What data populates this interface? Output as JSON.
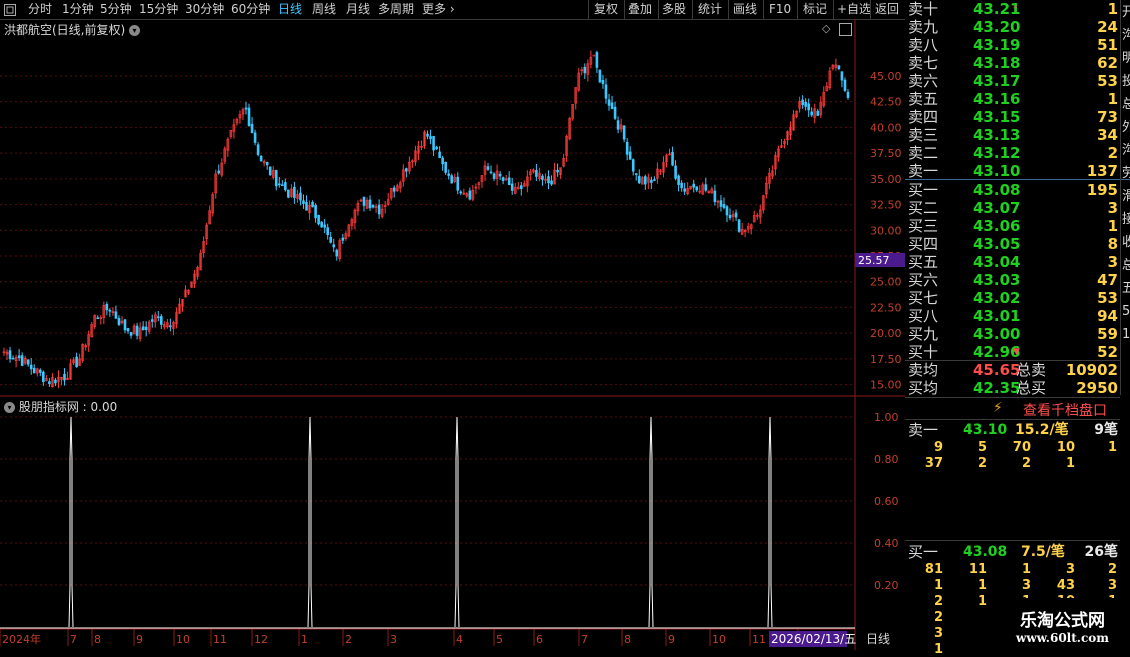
{
  "toolbar": {
    "periods": [
      "分时",
      "1分钟",
      "5分钟",
      "15分钟",
      "30分钟",
      "60分钟",
      "日线",
      "周线",
      "月线",
      "多周期",
      "更多"
    ],
    "active": "日线",
    "actions": [
      "复权",
      "叠加",
      "多股",
      "统计",
      "画线",
      "F10",
      "标记",
      "+自选",
      "返回"
    ]
  },
  "chart": {
    "title": "洪都航空(日线,前复权)",
    "price_ticks": [
      "45.00",
      "42.50",
      "40.00",
      "37.50",
      "35.00",
      "32.50",
      "30.00",
      "27.50",
      "25.00",
      "22.50",
      "20.00",
      "17.50",
      "15.00"
    ],
    "crosshair_price": "25.57",
    "indicator_title": "股朋指标网 : 0.00",
    "indicator_ticks": [
      "1.00",
      "0.80",
      "0.60",
      "0.40",
      "0.20"
    ],
    "x_labels": [
      "2024年",
      "7",
      "8",
      "9",
      "10",
      "11",
      "12",
      "1",
      "2",
      "3",
      "4",
      "5",
      "6",
      "7",
      "8",
      "9",
      "10",
      "11",
      "12"
    ],
    "date_badge": "2026/02/13/五",
    "period_label": "日线"
  },
  "chart_data": {
    "type": "line",
    "title": "洪都航空(日线,前复权)",
    "ylim": [
      13.5,
      48.5
    ],
    "x_categories": [
      "2024年",
      "7",
      "8",
      "9",
      "10",
      "11",
      "12",
      "1",
      "2",
      "3",
      "4",
      "5",
      "6",
      "7",
      "8",
      "9",
      "10",
      "11",
      "12"
    ],
    "series": [
      {
        "values": [
          18.2,
          17.6,
          16.4,
          15.4,
          15.8,
          17.5,
          21.5,
          22.5,
          20.5,
          20.0,
          21.5,
          21.0,
          23.5,
          27.0,
          35.0,
          39.0,
          42.0,
          37.0,
          35.0,
          33.5,
          32.5,
          31.0,
          27.5,
          31.5,
          33.0,
          32.0,
          34.5,
          37.0,
          39.5,
          36.5,
          34.5,
          33.5,
          36.0,
          35.0,
          33.5,
          35.5,
          34.5,
          36.0,
          44.5,
          47.0,
          43.0,
          39.5,
          35.0,
          34.5,
          37.5,
          34.0,
          34.5,
          33.5,
          32.0,
          30.0,
          31.5,
          36.0,
          40.0,
          42.5,
          41.0,
          46.5,
          43.1
        ]
      },
      {
        "name": "股朋指标网",
        "values": [
          0,
          1,
          0,
          0,
          1,
          0,
          1,
          0,
          1,
          0,
          1,
          0
        ],
        "ylim": [
          0,
          1
        ]
      }
    ]
  },
  "orderbook": {
    "asks": [
      {
        "label": "卖十",
        "price": "43.21",
        "vol": "1",
        "mark": "*"
      },
      {
        "label": "卖九",
        "price": "43.20",
        "vol": "24"
      },
      {
        "label": "卖八",
        "price": "43.19",
        "vol": "51"
      },
      {
        "label": "卖七",
        "price": "43.18",
        "vol": "62"
      },
      {
        "label": "卖六",
        "price": "43.17",
        "vol": "53"
      },
      {
        "label": "卖五",
        "price": "43.16",
        "vol": "1"
      },
      {
        "label": "卖四",
        "price": "43.15",
        "vol": "73"
      },
      {
        "label": "卖三",
        "price": "43.13",
        "vol": "34"
      },
      {
        "label": "卖二",
        "price": "43.12",
        "vol": "2"
      },
      {
        "label": "卖一",
        "price": "43.10",
        "vol": "137"
      }
    ],
    "bids": [
      {
        "label": "买一",
        "price": "43.08",
        "vol": "195"
      },
      {
        "label": "买二",
        "price": "43.07",
        "vol": "3"
      },
      {
        "label": "买三",
        "price": "43.06",
        "vol": "1"
      },
      {
        "label": "买四",
        "price": "43.05",
        "vol": "8"
      },
      {
        "label": "买五",
        "price": "43.04",
        "vol": "3"
      },
      {
        "label": "买六",
        "price": "43.03",
        "vol": "47"
      },
      {
        "label": "买七",
        "price": "43.02",
        "vol": "53"
      },
      {
        "label": "买八",
        "price": "43.01",
        "vol": "94"
      },
      {
        "label": "买九",
        "price": "43.00",
        "vol": "59"
      },
      {
        "label": "买十",
        "price": "42.96",
        "vol": "52",
        "mark": "▼"
      }
    ],
    "sell_avg_label": "卖均",
    "sell_avg": "45.65",
    "total_sell_label": "总卖",
    "total_sell": "10902",
    "buy_avg_label": "买均",
    "buy_avg": "42.35",
    "total_buy_label": "总买",
    "total_buy": "2950",
    "depth_button": "查看千档盘口",
    "ask1_detail": {
      "label": "卖一",
      "price": "43.10",
      "per": "15.2/笔",
      "count": "9笔"
    },
    "ask1_queue": [
      [
        "9",
        "5",
        "70",
        "10",
        "1"
      ],
      [
        "37",
        "2",
        "2",
        "1",
        ""
      ]
    ],
    "bid1_detail": {
      "label": "买一",
      "price": "43.08",
      "per": "7.5/笔",
      "count": "26笔"
    },
    "bid1_queue": [
      [
        "81",
        "11",
        "1",
        "3",
        "2"
      ],
      [
        "1",
        "1",
        "3",
        "43",
        "3"
      ],
      [
        "2",
        "1",
        "1",
        "10",
        "1"
      ],
      [
        "2",
        "",
        "",
        "",
        ""
      ],
      [
        "3",
        "",
        "",
        "",
        ""
      ],
      [
        "1",
        "",
        "",
        "",
        ""
      ]
    ]
  },
  "side_strip": [
    "开",
    "沟",
    "明",
    "投",
    "总",
    "外",
    "沟",
    "劳",
    "滑",
    "接",
    "收",
    "总",
    "五",
    "5",
    "1"
  ],
  "watermark": {
    "title": "乐淘公式网",
    "url": "www.60lt.com"
  },
  "colors": {
    "up": "#ff3b3b",
    "down": "#3cc8ff",
    "grid": "#5a0c0c",
    "axis": "#8b1a1a",
    "ask": "#1fd11f",
    "bid": "#1fd11f",
    "vol": "#ffd24a",
    "badge": "#4b1a8c"
  }
}
